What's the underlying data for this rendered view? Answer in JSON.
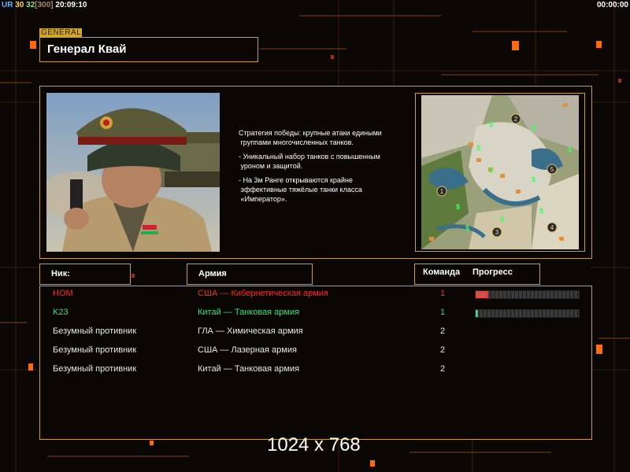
{
  "status_bar": {
    "a": "UR",
    "b": "30",
    "c": "32",
    "d": "[300]",
    "time": "20:09:10",
    "timer": "00:00:00",
    "colors": {
      "a": "#5ab4ff",
      "b": "#ffd84a",
      "c": "#8fe07a",
      "d": "#a78a6a",
      "time": "#ffffff"
    }
  },
  "general": {
    "tag": "GENERAL",
    "name": "Генерал Квай",
    "description": [
      "Стратегия победы: крупные атаки едиными\n группами многочисленных танков.",
      "- Уникальный набор танков с повышенным\n уроном и защитой.",
      "- На 3м Ранге открываются крайне\n эффективные тяжёлые танки класса\n «Император»."
    ]
  },
  "minimap": {
    "start_positions": [
      "1",
      "2",
      "3",
      "4",
      "5"
    ],
    "resource_icon": "dollar-sign-icon"
  },
  "lobby": {
    "headers": {
      "nick": "Ник:",
      "army": "Армия",
      "team": "Команда",
      "progress": "Прогресс"
    },
    "players": [
      {
        "nick": "HOM",
        "army": "США — Кибернетическая армия",
        "team": "1",
        "color": "#ff2a1a",
        "progress": 0.12,
        "progress_color": "#ff3a2a"
      },
      {
        "nick": "K23",
        "army": "Китай — Танковая армия",
        "team": "1",
        "color": "#34e07a",
        "progress": 0.02,
        "progress_color": "#40e090"
      },
      {
        "nick": "Безумный противник",
        "army": "ГЛА — Химическая армия",
        "team": "2",
        "color": "#e8e8e8"
      },
      {
        "nick": "Безумный противник",
        "army": "США — Лазерная армия",
        "team": "2",
        "color": "#e8e8e8"
      },
      {
        "nick": "Безумный противник",
        "army": "Китай — Танковая армия",
        "team": "2",
        "color": "#e8e8e8"
      }
    ]
  },
  "resolution": "1024 x 768",
  "colors": {
    "accent": "#c7a030",
    "background": "#0b0705",
    "orange": "#ff7a1a"
  }
}
